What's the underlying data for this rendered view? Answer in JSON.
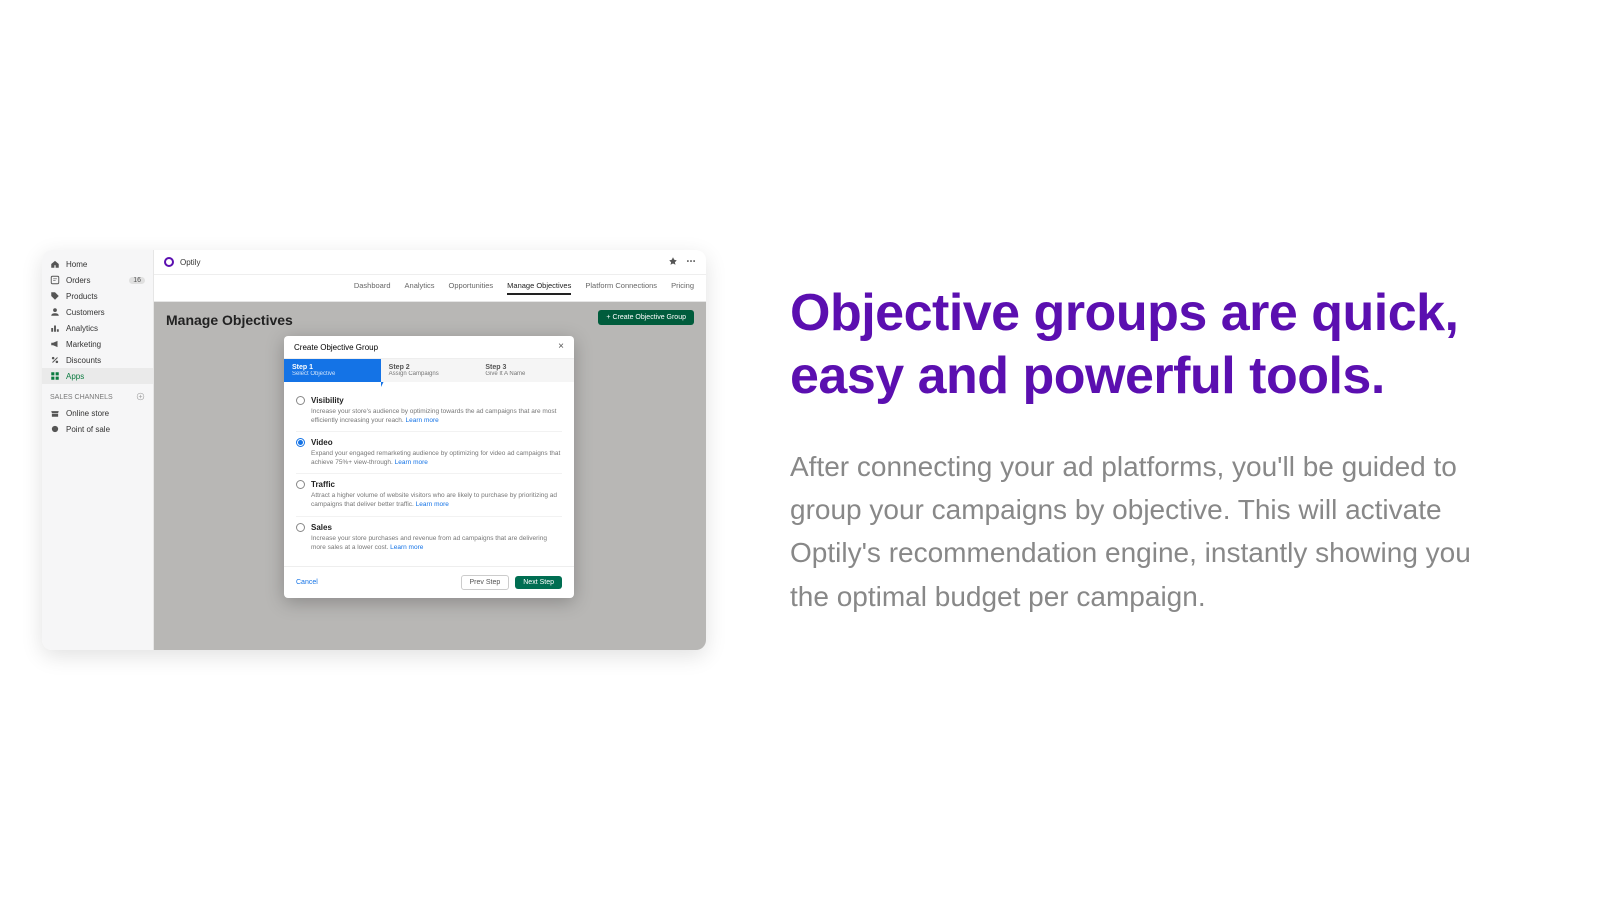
{
  "marketing": {
    "headline": "Objective groups are quick, easy and powerful tools.",
    "body": "After connecting your ad platforms, you'll be guided to group your campaigns by objective. This will activate Optily's recommendation engine, instantly showing you the optimal budget per campaign."
  },
  "brand": {
    "name": "Optily"
  },
  "sidebar": {
    "items": [
      {
        "label": "Home"
      },
      {
        "label": "Orders",
        "badge": "16"
      },
      {
        "label": "Products"
      },
      {
        "label": "Customers"
      },
      {
        "label": "Analytics"
      },
      {
        "label": "Marketing"
      },
      {
        "label": "Discounts"
      },
      {
        "label": "Apps"
      }
    ],
    "section_header": "SALES CHANNELS",
    "channels": [
      {
        "label": "Online store"
      },
      {
        "label": "Point of sale"
      }
    ]
  },
  "tabs": {
    "items": [
      "Dashboard",
      "Analytics",
      "Opportunities",
      "Manage Objectives",
      "Platform Connections",
      "Pricing"
    ]
  },
  "page": {
    "title": "Manage Objectives",
    "create_button": "+ Create Objective Group"
  },
  "modal": {
    "title": "Create Objective Group",
    "steps": [
      {
        "title": "Step 1",
        "sub": "Select Objective"
      },
      {
        "title": "Step 2",
        "sub": "Assign Campaigns"
      },
      {
        "title": "Step 3",
        "sub": "Give It A Name"
      }
    ],
    "options": [
      {
        "title": "Visibility",
        "desc": "Increase your store's audience by optimizing towards the ad campaigns that are most efficiently increasing your reach.",
        "learn": "Learn more"
      },
      {
        "title": "Video",
        "desc": "Expand your engaged remarketing audience by optimizing for video ad campaigns that achieve 75%+ view-through.",
        "learn": "Learn more"
      },
      {
        "title": "Traffic",
        "desc": "Attract a higher volume of website visitors who are likely to purchase by prioritizing ad campaigns that deliver better traffic.",
        "learn": "Learn more"
      },
      {
        "title": "Sales",
        "desc": "Increase your store purchases and revenue from ad campaigns that are delivering more sales at a lower cost.",
        "learn": "Learn more"
      }
    ],
    "footer": {
      "cancel": "Cancel",
      "prev": "Prev Step",
      "next": "Next Step"
    }
  }
}
